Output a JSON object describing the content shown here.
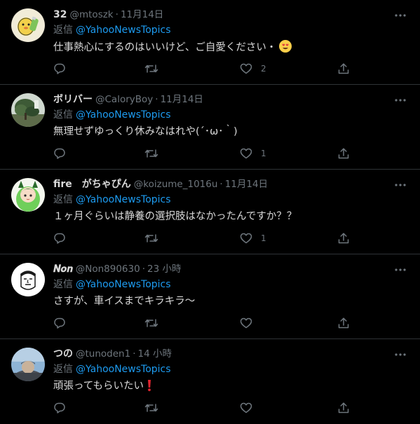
{
  "replies": [
    {
      "name": "32",
      "handle": "@mtoszk",
      "separator": "·",
      "time": "11月14日",
      "replying_label": "返信",
      "mention": "@YahooNewsTopics",
      "text": "仕事熱心にするのはいいけど、ご自愛ください・",
      "emoji": "smiling-face-with-heart-eyes-emoji",
      "avatar": "yellow-duck-avatar",
      "likes": "2"
    },
    {
      "name": "ボリバー",
      "handle": "@CaloryBoy",
      "separator": "·",
      "time": "11月14日",
      "replying_label": "返信",
      "mention": "@YahooNewsTopics",
      "text": "無理せずゆっくり休みなはれや(´･ω･｀)",
      "avatar": "tree-landscape-avatar",
      "likes": "1"
    },
    {
      "name": "fire　がちゃぴん",
      "handle": "@koizume_1016u",
      "separator": "·",
      "time": "11月14日",
      "replying_label": "返信",
      "mention": "@YahooNewsTopics",
      "text": "１ヶ月ぐらいは静養の選択肢はなかったんですか？？",
      "avatar": "green-anime-character-avatar",
      "likes": "1"
    },
    {
      "name": "𝑵𝒐𝒏",
      "handle": "@Non890630",
      "separator": "·",
      "time": "23 小時",
      "replying_label": "返信",
      "mention": "@YahooNewsTopics",
      "text": "さすが、車イスまでキラキラ～",
      "avatar": "sketch-face-avatar",
      "likes": ""
    },
    {
      "name": "つの",
      "handle": "@tunoden1",
      "separator": "·",
      "time": "14 小時",
      "replying_label": "返信",
      "mention": "@YahooNewsTopics",
      "text": "頑張ってもらいたい",
      "emoji": "exclamation-mark-emoji",
      "avatar": "person-sky-photo-avatar",
      "likes": ""
    }
  ],
  "colors": {
    "background": "#000000",
    "text": "#d9d9d9",
    "muted": "#6e767d",
    "link": "#1d9bf0",
    "divider": "#2f3336"
  },
  "icons": {
    "reply": "reply-icon",
    "retweet": "retweet-icon",
    "like": "heart-icon",
    "share": "share-icon",
    "more": "more-dots-icon"
  }
}
